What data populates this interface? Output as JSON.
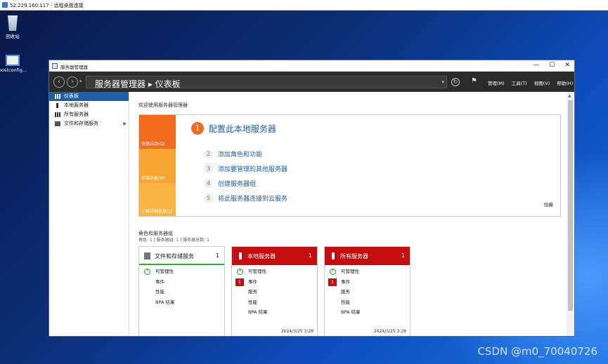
{
  "rdp": {
    "title": "52.229.160.117 - 远程桌面连接"
  },
  "desktop": {
    "icons": [
      {
        "label": "回收站",
        "icon": "recycle-bin-icon"
      },
      {
        "label": "bostconfig...",
        "icon": "bginfo-icon"
      }
    ]
  },
  "window": {
    "title": "服务器管理器",
    "controls": [
      "—",
      "☐",
      "✕"
    ]
  },
  "toolbar": {
    "breadcrumb": "服务器管理器 ▸ 仪表板",
    "menus": [
      "管理(M)",
      "工具(T)",
      "视图(V)",
      "帮助(H)"
    ]
  },
  "sidebar": {
    "items": [
      {
        "label": "仪表板",
        "icon": "dashboard-icon"
      },
      {
        "label": "本地服务器",
        "icon": "server-icon"
      },
      {
        "label": "所有服务器",
        "icon": "servers-icon"
      },
      {
        "label": "文件和存储服务",
        "icon": "storage-icon"
      }
    ]
  },
  "welcome": {
    "title": "欢迎使用服务器管理器",
    "tiles": [
      "快速启动(Q)",
      "新增功能(W)",
      "了解详细信息(L)"
    ],
    "primary_step": {
      "num": "1",
      "label": "配置此本地服务器"
    },
    "steps": [
      {
        "num": "2",
        "label": "添加角色和功能"
      },
      {
        "num": "3",
        "label": "添加要管理的其他服务器"
      },
      {
        "num": "4",
        "label": "创建服务器组"
      },
      {
        "num": "5",
        "label": "将此服务器连接到云服务"
      }
    ],
    "hide": "隐藏"
  },
  "roles": {
    "title": "角色和服务器组",
    "summary": "角色: 1 | 服务器组: 1 | 服务器总数: 1",
    "cards": [
      {
        "title": "文件和存储服务",
        "count": "1",
        "rows": [
          {
            "label": "可管理性",
            "status": "ok"
          },
          {
            "label": "事件"
          },
          {
            "label": "性能"
          },
          {
            "label": "BPA 结果"
          }
        ],
        "timestamp": ""
      },
      {
        "title": "本地服务器",
        "count": "1",
        "rows": [
          {
            "label": "可管理性",
            "status": "ok"
          },
          {
            "label": "事件",
            "badge": "1"
          },
          {
            "label": "服务"
          },
          {
            "label": "性能"
          },
          {
            "label": "BPA 结果"
          }
        ],
        "timestamp": "2024/3/25 3:28"
      },
      {
        "title": "所有服务器",
        "count": "1",
        "rows": [
          {
            "label": "可管理性",
            "status": "ok"
          },
          {
            "label": "事件",
            "badge": "1"
          },
          {
            "label": "服务"
          },
          {
            "label": "性能"
          },
          {
            "label": "BPA 结果"
          }
        ],
        "timestamp": "2024/3/25 3:28"
      }
    ]
  },
  "watermark": "CSDN @m0_70040726",
  "colors": {
    "accent": "#1e5fa8",
    "orange": "#f26b1d",
    "alert_red": "#c40e0e",
    "ok_green": "#2a9a2a"
  }
}
